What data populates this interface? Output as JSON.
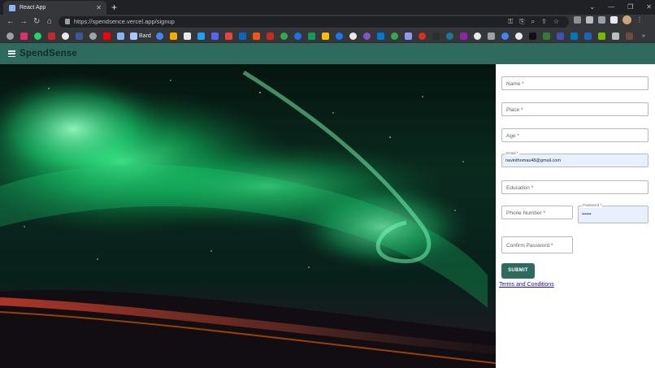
{
  "browser": {
    "tab_title": "React App",
    "tab_close": "✕",
    "new_tab": "+",
    "url": "https://spendsence.vercel.app/signup",
    "bookmark_label": "Bard",
    "window_controls": [
      "⌄",
      "—",
      "❐",
      "✕"
    ],
    "nav": {
      "back": "←",
      "forward": "→",
      "reload": "↻",
      "home": "⌂"
    },
    "omni_icons": [
      "⚿",
      "⎘",
      "⌕",
      "⇪",
      "☆"
    ]
  },
  "app": {
    "brand": "SpendSense",
    "brand_color": "#0e2d28",
    "bar_color": "#2e6b5e"
  },
  "form": {
    "name_label": "Name",
    "place_label": "Place",
    "age_label": "Age",
    "email_label": "Email",
    "email_value": "navinthomas48@gmail.com",
    "education_label": "Education",
    "phone_label": "Phone Number",
    "password_label": "Password",
    "password_value": "••••••",
    "confirm_password_label": "Confirm Password",
    "required_mark": " *",
    "submit_label": "SUBMIT",
    "terms_label": "Terms and Conditions"
  }
}
